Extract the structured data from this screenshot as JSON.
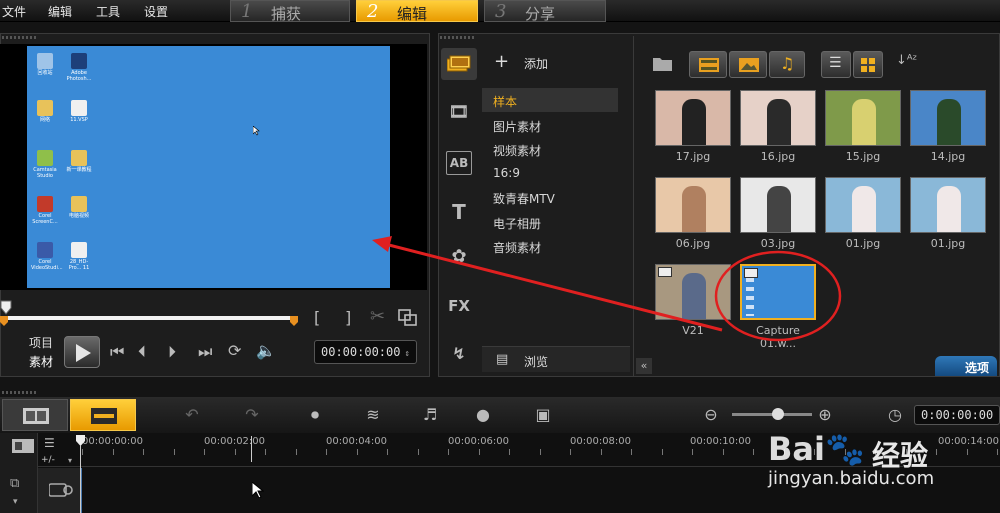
{
  "menu": [
    "文件",
    "编辑",
    "工具",
    "设置"
  ],
  "steps": [
    {
      "num": "1",
      "label": "捕获"
    },
    {
      "num": "2",
      "label": "编辑"
    },
    {
      "num": "3",
      "label": "分享"
    }
  ],
  "preview": {
    "desktop_icons": [
      {
        "label": "回收站",
        "color": "#9fc4e8"
      },
      {
        "label": "Adobe Photosh...",
        "color": "#1d3f7a"
      },
      {
        "label": "网络",
        "color": "#e8c25a"
      },
      {
        "label": "11.VSP",
        "color": "#f0f0f0"
      },
      {
        "label": "Camtasia Studio",
        "color": "#8fbf4a"
      },
      {
        "label": "新一课教程",
        "color": "#e8c25a"
      },
      {
        "label": "Corel ScreenC...",
        "color": "#c23a2a"
      },
      {
        "label": "电脑视频",
        "color": "#e8c25a"
      },
      {
        "label": "Corel VideoStudi...",
        "color": "#3a5aa8"
      },
      {
        "label": "28_HD-Pro... 11",
        "color": "#f0f0f0"
      }
    ],
    "mode_project": "项目",
    "mode_clip": "素材",
    "timecode": "00:00:00:00"
  },
  "library": {
    "add_label": "添加",
    "categories": [
      "样本",
      "图片素材",
      "视频素材",
      "16:9",
      "致青春MTV",
      "电子相册",
      "音频素材"
    ],
    "browse_label": "浏览",
    "options_label": "选项",
    "thumbnails": [
      {
        "label": "17.jpg",
        "bg": "#d9b8a8",
        "fg": "#222"
      },
      {
        "label": "16.jpg",
        "bg": "#e6d1c8",
        "fg": "#2a2a2a"
      },
      {
        "label": "15.jpg",
        "bg": "#7f9a4a",
        "fg": "#d8d070"
      },
      {
        "label": "14.jpg",
        "bg": "#4a86c8",
        "fg": "#2a4a2a"
      },
      {
        "label": "06.jpg",
        "bg": "#e8c8a8",
        "fg": "#b08060"
      },
      {
        "label": "03.jpg",
        "bg": "#e8e8e8",
        "fg": "#444"
      },
      {
        "label": "01.jpg",
        "bg": "#8ab8d8",
        "fg": "#f0e8e8"
      },
      {
        "label": "01.jpg",
        "bg": "#8ab8d8",
        "fg": "#f0e8e8"
      },
      {
        "label": "V21",
        "bg": "#a89880",
        "fg": "#5a6a8a"
      },
      {
        "label": "Capture 01.w...",
        "bg": "#3a8ad6",
        "fg": "#cfe2f6"
      }
    ]
  },
  "timeline": {
    "timecode": "0:00:00:00",
    "ruler": [
      "00:00:00:00",
      "00:00:02:00",
      "00:00:04:00",
      "00:00:06:00",
      "00:00:08:00",
      "00:00:10:00",
      "00:00:14:00"
    ],
    "track_label": "+/-"
  },
  "watermark": {
    "text": "经验",
    "url": "jingyan.baidu.com"
  },
  "colors": {
    "accent": "#f0b020",
    "annotation": "#e02020",
    "desktop": "#3a8ad6"
  }
}
